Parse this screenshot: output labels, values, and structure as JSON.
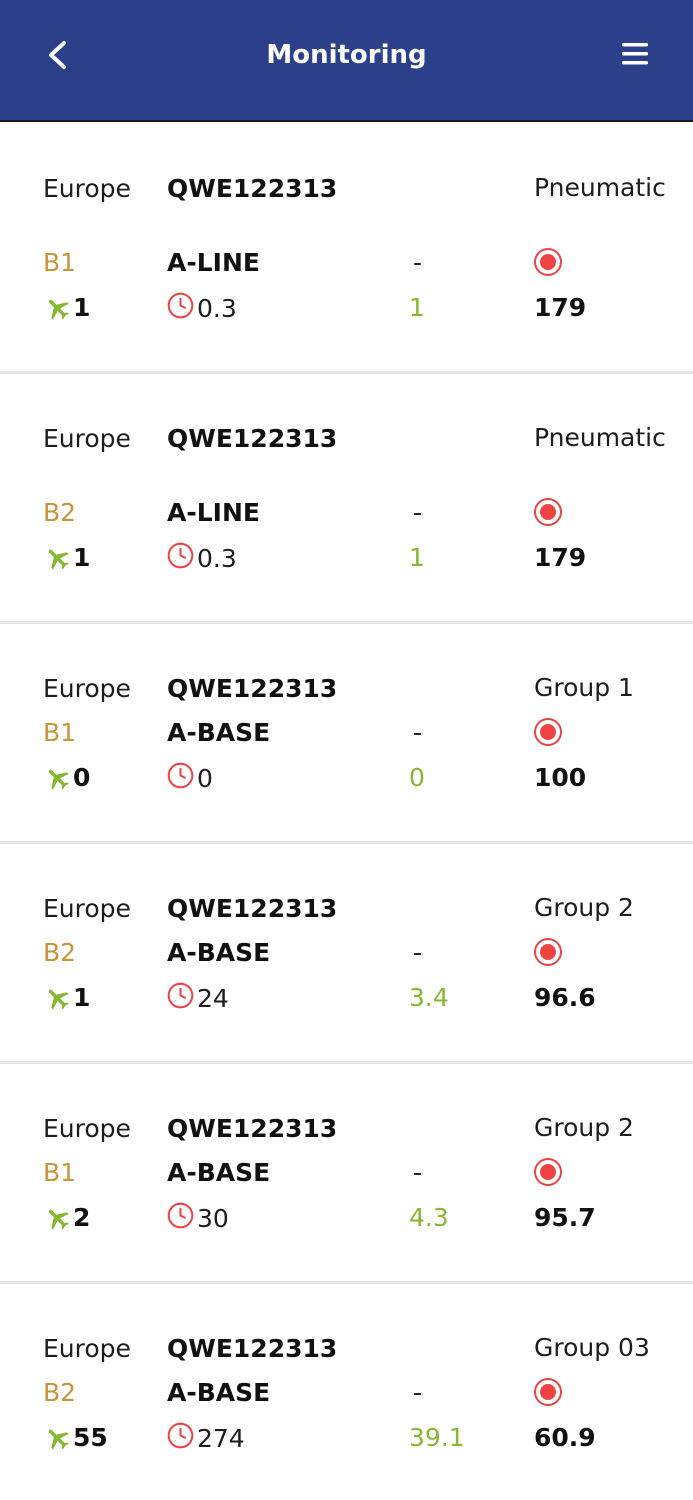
{
  "header": {
    "title": "Monitoring"
  },
  "colors": {
    "header_bg": "#2c3f8a",
    "level": "#c8953b",
    "used": "#86b832",
    "status": "#ee4343"
  },
  "icons": {
    "back": "chevron-left-icon",
    "menu": "hamburger-menu-icon",
    "plane": "plane-icon",
    "clock": "clock-icon",
    "status": "red-record-dot-icon"
  },
  "cards": [
    {
      "region": "Europe",
      "code": "QWE122313",
      "category": "Pneumatic",
      "level": "B1",
      "line": "A-LINE",
      "dash": "-",
      "count": "1",
      "hours": "0.3",
      "used": "1",
      "remaining": "179"
    },
    {
      "region": "Europe",
      "code": "QWE122313",
      "category": "Pneumatic",
      "level": "B2",
      "line": "A-LINE",
      "dash": "-",
      "count": "1",
      "hours": "0.3",
      "used": "1",
      "remaining": "179"
    },
    {
      "region": "Europe",
      "code": "QWE122313",
      "category": "Group 1",
      "level": "B1",
      "line": "A-BASE",
      "dash": "-",
      "count": "0",
      "hours": "0",
      "used": "0",
      "remaining": "100"
    },
    {
      "region": "Europe",
      "code": "QWE122313",
      "category": "Group 2",
      "level": "B2",
      "line": "A-BASE",
      "dash": "-",
      "count": "1",
      "hours": "24",
      "used": "3.4",
      "remaining": "96.6"
    },
    {
      "region": "Europe",
      "code": "QWE122313",
      "category": "Group 2",
      "level": "B1",
      "line": "A-BASE",
      "dash": "-",
      "count": "2",
      "hours": "30",
      "used": "4.3",
      "remaining": "95.7"
    },
    {
      "region": "Europe",
      "code": "QWE122313",
      "category": "Group 03",
      "level": "B2",
      "line": "A-BASE",
      "dash": "-",
      "count": "55",
      "hours": "274",
      "used": "39.1",
      "remaining": "60.9"
    }
  ]
}
